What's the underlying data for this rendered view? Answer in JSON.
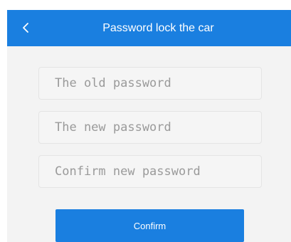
{
  "header": {
    "title": "Password lock the car",
    "back_icon": "chevron-left-icon"
  },
  "form": {
    "old_password": {
      "value": "",
      "placeholder": "The old password"
    },
    "new_password": {
      "value": "",
      "placeholder": "The new password"
    },
    "confirm_password": {
      "value": "",
      "placeholder": "Confirm new password"
    },
    "confirm_label": "Confirm"
  },
  "colors": {
    "accent": "#1a7fe0",
    "background": "#f3f3f3",
    "input_background": "#f5f5f5"
  }
}
